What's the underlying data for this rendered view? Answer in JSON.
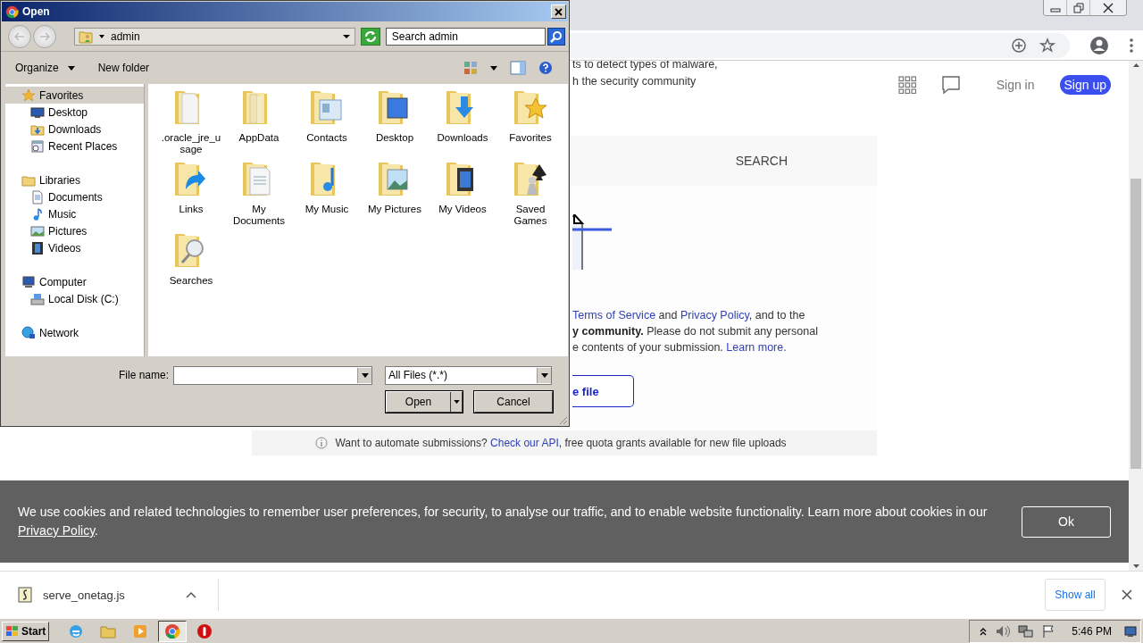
{
  "browser": {
    "page": {
      "intro_lines": [
        "ts to detect types of malware,",
        "h the security community"
      ],
      "header": {
        "sign_in": "Sign in",
        "sign_up": "Sign up"
      },
      "search_tab": "SEARCH",
      "terms_lines": [
        [
          {
            "kind": "link",
            "text": "Terms of Service"
          },
          {
            "kind": "text",
            "text": " and "
          },
          {
            "kind": "link",
            "text": "Privacy Policy"
          },
          {
            "kind": "text",
            "text": ", and to the"
          }
        ],
        [
          {
            "kind": "bold",
            "text": "y community."
          },
          {
            "kind": "text",
            "text": " Please do not submit any personal"
          }
        ],
        [
          {
            "kind": "text",
            "text": "e contents of your submission. "
          },
          {
            "kind": "link",
            "text": "Learn more."
          }
        ]
      ],
      "upload_button": "e file",
      "footer": [
        {
          "kind": "text",
          "text": "Want to automate submissions? "
        },
        {
          "kind": "link",
          "text": "Check our API"
        },
        {
          "kind": "text",
          "text": ", free quota grants available for new file uploads"
        }
      ],
      "cookie": {
        "text": [
          {
            "kind": "text",
            "text": "We use cookies and related technologies to remember user preferences, for security, to analyse our traffic, and to enable website functionality. Learn more about cookies in our "
          },
          {
            "kind": "link",
            "text": "Privacy Policy"
          },
          {
            "kind": "text",
            "text": "."
          }
        ],
        "button": "Ok"
      }
    },
    "download": {
      "file": "serve_onetag.js",
      "show_all": "Show all"
    }
  },
  "dialog": {
    "title": "Open",
    "location": "admin",
    "search": {
      "placeholder": "Search admin"
    },
    "toolbar": [
      "Organize",
      "New folder"
    ],
    "nav": [
      {
        "label": "Favorites",
        "kind": "star",
        "selected": true,
        "children": [
          {
            "label": "Desktop",
            "kind": "desktop",
            "selected": false
          },
          {
            "label": "Downloads",
            "kind": "downloads",
            "selected": false
          },
          {
            "label": "Recent Places",
            "kind": "recent",
            "selected": false
          }
        ]
      },
      {
        "label": "Libraries",
        "kind": "library",
        "selected": false,
        "children": [
          {
            "label": "Documents",
            "kind": "document",
            "selected": false
          },
          {
            "label": "Music",
            "kind": "music",
            "selected": false
          },
          {
            "label": "Pictures",
            "kind": "picture",
            "selected": false
          },
          {
            "label": "Videos",
            "kind": "video",
            "selected": false
          }
        ]
      },
      {
        "label": "Computer",
        "kind": "computer",
        "selected": false,
        "children": [
          {
            "label": "Local Disk (C:)",
            "kind": "disk",
            "selected": false
          }
        ]
      },
      {
        "label": "Network",
        "kind": "network",
        "selected": false
      }
    ],
    "files": [
      {
        "name": ".oracle_jre_usage",
        "kind": "document"
      },
      {
        "name": "AppData",
        "kind": "plain"
      },
      {
        "name": "Contacts",
        "kind": "contact"
      },
      {
        "name": "Desktop",
        "kind": "desktop"
      },
      {
        "name": "Downloads",
        "kind": "download"
      },
      {
        "name": "Favorites",
        "kind": "star"
      },
      {
        "name": "Links",
        "kind": "link"
      },
      {
        "name": "My Documents",
        "kind": "documents"
      },
      {
        "name": "My Music",
        "kind": "music"
      },
      {
        "name": "My Pictures",
        "kind": "picture"
      },
      {
        "name": "My Videos",
        "kind": "video"
      },
      {
        "name": "Saved Games",
        "kind": "games"
      },
      {
        "name": "Searches",
        "kind": "search"
      }
    ],
    "file_name_label": "File name:",
    "file_type": "All Files (*.*)",
    "buttons": [
      {
        "label": "Open",
        "kind": "split"
      },
      {
        "label": "Cancel",
        "kind": "plain"
      }
    ]
  },
  "taskbar": {
    "start": "Start",
    "apps": [
      {
        "kind": "ie",
        "selected": false
      },
      {
        "kind": "explorer",
        "selected": false
      },
      {
        "kind": "media",
        "selected": false
      },
      {
        "kind": "chrome",
        "selected": true
      },
      {
        "kind": "opera",
        "selected": false
      }
    ],
    "time": "5:46 PM"
  }
}
